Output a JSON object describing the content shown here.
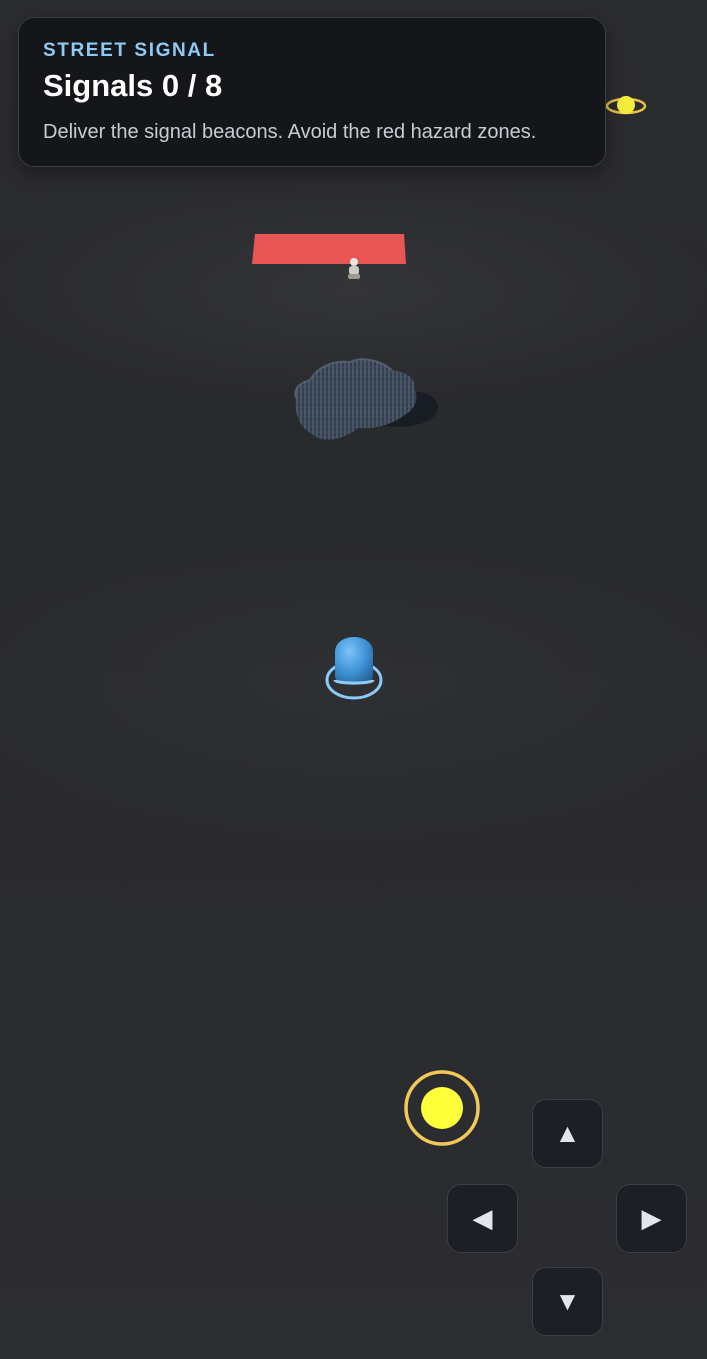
{
  "hud": {
    "eyebrow": "STREET SIGNAL",
    "title": "Signals 0 / 8",
    "description": "Deliver the signal beacons. Avoid the red hazard zones."
  },
  "controls": {
    "up": "▲",
    "left": "◀",
    "right": "▶",
    "down": "▼"
  },
  "colors": {
    "hazard": "#e85555",
    "player": "#4a9fe0",
    "player_ring": "#8ccbf7",
    "beacon": "#ffff3a",
    "beacon_ring": "#f2c85a"
  }
}
